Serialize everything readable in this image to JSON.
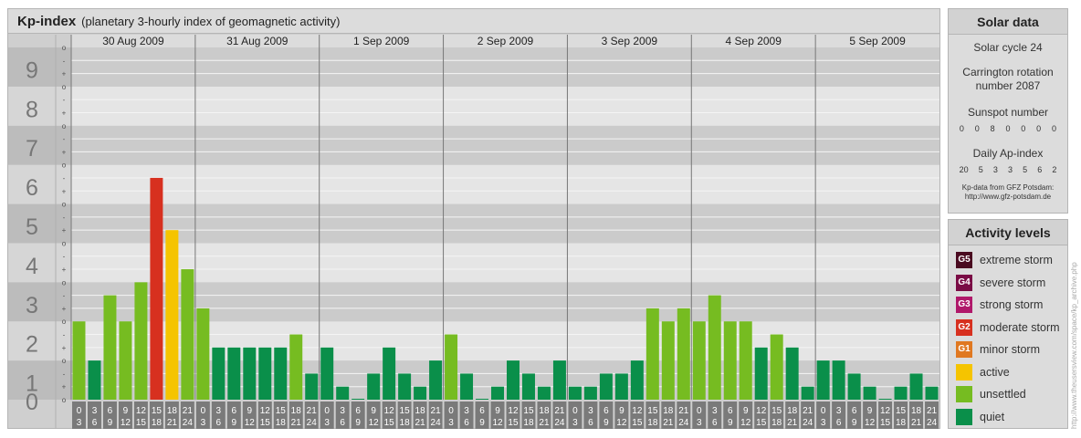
{
  "header": {
    "title": "Kp-index",
    "subtitle": "(planetary 3-hourly index of geomagnetic activity)"
  },
  "chart_data": {
    "type": "bar",
    "title": "Kp-index",
    "subtitle": "(planetary 3-hourly index of geomagnetic activity)",
    "ylim": [
      0,
      9
    ],
    "y_ticks": [
      "0",
      "1",
      "2",
      "3",
      "4",
      "5",
      "6",
      "7",
      "8",
      "9"
    ],
    "y_sub_ticks": [
      "o",
      "+",
      "-"
    ],
    "days": [
      "30 Aug 2009",
      "31 Aug 2009",
      "1 Sep 2009",
      "2 Sep 2009",
      "3 Sep 2009",
      "4 Sep 2009",
      "5 Sep 2009"
    ],
    "time_start": [
      "0",
      "3",
      "6",
      "9",
      "12",
      "15",
      "18",
      "21"
    ],
    "time_end": [
      "3",
      "6",
      "9",
      "12",
      "15",
      "18",
      "21",
      "24"
    ],
    "values": [
      [
        2.0,
        1.0,
        2.667,
        2.0,
        3.0,
        5.667,
        4.333,
        3.333
      ],
      [
        2.333,
        1.333,
        1.333,
        1.333,
        1.333,
        1.333,
        1.667,
        0.667
      ],
      [
        1.333,
        0.333,
        0.0,
        0.667,
        1.333,
        0.667,
        0.333,
        1.0
      ],
      [
        1.667,
        0.667,
        0.0,
        0.333,
        1.0,
        0.667,
        0.333,
        1.0
      ],
      [
        0.333,
        0.333,
        0.667,
        0.667,
        1.0,
        2.333,
        2.0,
        2.333
      ],
      [
        2.0,
        2.667,
        2.0,
        2.0,
        1.333,
        1.667,
        1.333,
        0.333
      ],
      [
        1.0,
        1.0,
        0.667,
        0.333,
        0.0,
        0.333,
        0.667,
        0.333
      ]
    ],
    "level_colors": {
      "quiet": "#0a8f4a",
      "unsettled": "#76bc21",
      "active": "#f5c400",
      "G1": "#e07820",
      "G2": "#d7301f",
      "G3": "#b0186a",
      "G4": "#7a0c45",
      "G5": "#4a0a20"
    },
    "grid": true
  },
  "solar": {
    "title": "Solar data",
    "cycle": "Solar cycle 24",
    "carrington_1": "Carrington rotation",
    "carrington_2": "number 2087",
    "sunspot_label": "Sunspot number",
    "sunspots": [
      "0",
      "0",
      "8",
      "0",
      "0",
      "0",
      "0"
    ],
    "ap_label": "Daily Ap-index",
    "ap": [
      "20",
      "5",
      "3",
      "3",
      "5",
      "6",
      "2"
    ],
    "source_1": "Kp-data from GFZ Potsdam:",
    "source_2": "http://www.gfz-potsdam.de"
  },
  "activity": {
    "title": "Activity levels",
    "levels": [
      {
        "badge": "G5",
        "label": "extreme storm",
        "color": "#4a0a20"
      },
      {
        "badge": "G4",
        "label": "severe storm",
        "color": "#7a0c45"
      },
      {
        "badge": "G3",
        "label": "strong storm",
        "color": "#b0186a"
      },
      {
        "badge": "G2",
        "label": "moderate storm",
        "color": "#d7301f"
      },
      {
        "badge": "G1",
        "label": "minor storm",
        "color": "#e07820"
      },
      {
        "badge": "",
        "label": "active",
        "color": "#f5c400"
      },
      {
        "badge": "",
        "label": "unsettled",
        "color": "#76bc21"
      },
      {
        "badge": "",
        "label": "quiet",
        "color": "#0a8f4a"
      }
    ]
  },
  "credit": "http://www.theusersview.com/space/kp_archive.php"
}
